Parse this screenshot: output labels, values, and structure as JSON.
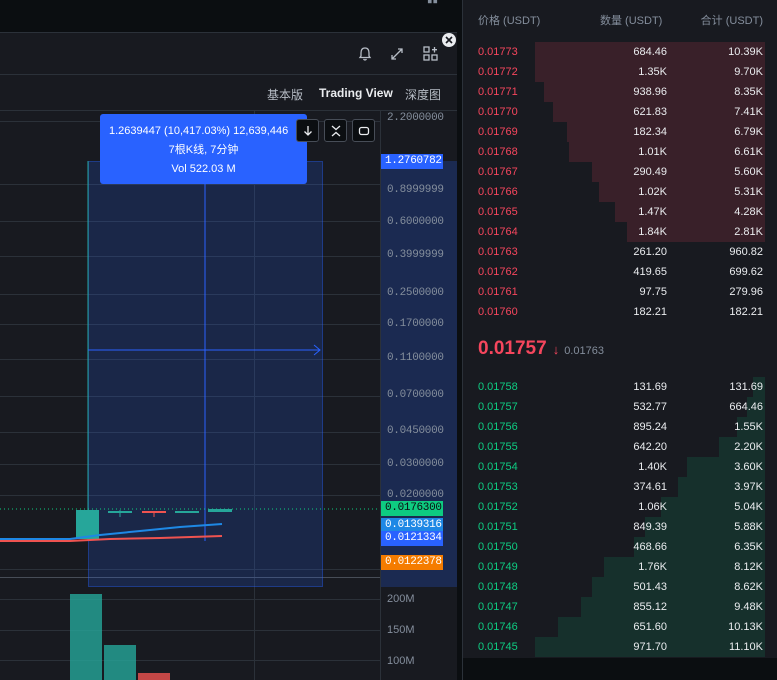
{
  "chart": {
    "view_tabs": [
      "基本版",
      "Trading View",
      "深度图"
    ],
    "active_tab": "Trading View",
    "toolbar_icons": [
      "bell-icon",
      "expand-icon",
      "add-widget-icon",
      "close-icon"
    ],
    "price_ticks": [
      "2.2000000",
      "0.8999999",
      "0.6000000",
      "0.3999999",
      "0.2500000",
      "0.1700000",
      "0.1100000",
      "0.0700000",
      "0.0450000",
      "0.0300000",
      "0.0200000"
    ],
    "price_tags": {
      "selected_top": "1.2760782",
      "last": "0.0176300",
      "ma1": "0.0139316",
      "ma2": "0.0121334",
      "ma3": "0.0122378"
    },
    "tooltip": {
      "line1": "1.2639447 (10,417.03%) 12,639,446",
      "line2": "7根K线, 7分钟",
      "line3": "Vol 522.03 M"
    },
    "volume_ticks": [
      "200M",
      "150M",
      "100M"
    ],
    "colors": {
      "up": "#26a69a",
      "down": "#ef5350",
      "select": "#2962ff",
      "ma_last": "#0ecb81",
      "ma1": "#1e88e5",
      "ma2": "#2962ff",
      "ma3": "#f57c00"
    }
  },
  "orderbook": {
    "headers": {
      "price": "价格 (USDT)",
      "qty": "数量 (USDT)",
      "total": "合计 (USDT)"
    },
    "asks": [
      {
        "price": "0.01773",
        "qty": "684.46",
        "total": "10.39K",
        "depth": 1.0
      },
      {
        "price": "0.01772",
        "qty": "1.35K",
        "total": "9.70K",
        "depth": 1.0
      },
      {
        "price": "0.01771",
        "qty": "938.96",
        "total": "8.35K",
        "depth": 0.96
      },
      {
        "price": "0.01770",
        "qty": "621.83",
        "total": "7.41K",
        "depth": 0.92
      },
      {
        "price": "0.01769",
        "qty": "182.34",
        "total": "6.79K",
        "depth": 0.86
      },
      {
        "price": "0.01768",
        "qty": "1.01K",
        "total": "6.61K",
        "depth": 0.85
      },
      {
        "price": "0.01767",
        "qty": "290.49",
        "total": "5.60K",
        "depth": 0.75
      },
      {
        "price": "0.01766",
        "qty": "1.02K",
        "total": "5.31K",
        "depth": 0.72
      },
      {
        "price": "0.01765",
        "qty": "1.47K",
        "total": "4.28K",
        "depth": 0.65
      },
      {
        "price": "0.01764",
        "qty": "1.84K",
        "total": "2.81K",
        "depth": 0.6
      },
      {
        "price": "0.01763",
        "qty": "261.20",
        "total": "960.82",
        "depth": 0
      },
      {
        "price": "0.01762",
        "qty": "419.65",
        "total": "699.62",
        "depth": 0
      },
      {
        "price": "0.01761",
        "qty": "97.75",
        "total": "279.96",
        "depth": 0
      },
      {
        "price": "0.01760",
        "qty": "182.21",
        "total": "182.21",
        "depth": 0
      }
    ],
    "last_price": "0.01757",
    "last_arrow": "↓",
    "ref_price": "0.01763",
    "bids": [
      {
        "price": "0.01758",
        "qty": "131.69",
        "total": "131.69",
        "depth": 0.05
      },
      {
        "price": "0.01757",
        "qty": "532.77",
        "total": "664.46",
        "depth": 0.08
      },
      {
        "price": "0.01756",
        "qty": "895.24",
        "total": "1.55K",
        "depth": 0.12
      },
      {
        "price": "0.01755",
        "qty": "642.20",
        "total": "2.20K",
        "depth": 0.2
      },
      {
        "price": "0.01754",
        "qty": "1.40K",
        "total": "3.60K",
        "depth": 0.34
      },
      {
        "price": "0.01753",
        "qty": "374.61",
        "total": "3.97K",
        "depth": 0.38
      },
      {
        "price": "0.01752",
        "qty": "1.06K",
        "total": "5.04K",
        "depth": 0.45
      },
      {
        "price": "0.01751",
        "qty": "849.39",
        "total": "5.88K",
        "depth": 0.52
      },
      {
        "price": "0.01750",
        "qty": "468.66",
        "total": "6.35K",
        "depth": 0.57
      },
      {
        "price": "0.01749",
        "qty": "1.76K",
        "total": "8.12K",
        "depth": 0.7
      },
      {
        "price": "0.01748",
        "qty": "501.43",
        "total": "8.62K",
        "depth": 0.75
      },
      {
        "price": "0.01747",
        "qty": "855.12",
        "total": "9.48K",
        "depth": 0.8
      },
      {
        "price": "0.01746",
        "qty": "651.60",
        "total": "10.13K",
        "depth": 0.9
      },
      {
        "price": "0.01745",
        "qty": "971.70",
        "total": "11.10K",
        "depth": 1.0
      }
    ]
  }
}
